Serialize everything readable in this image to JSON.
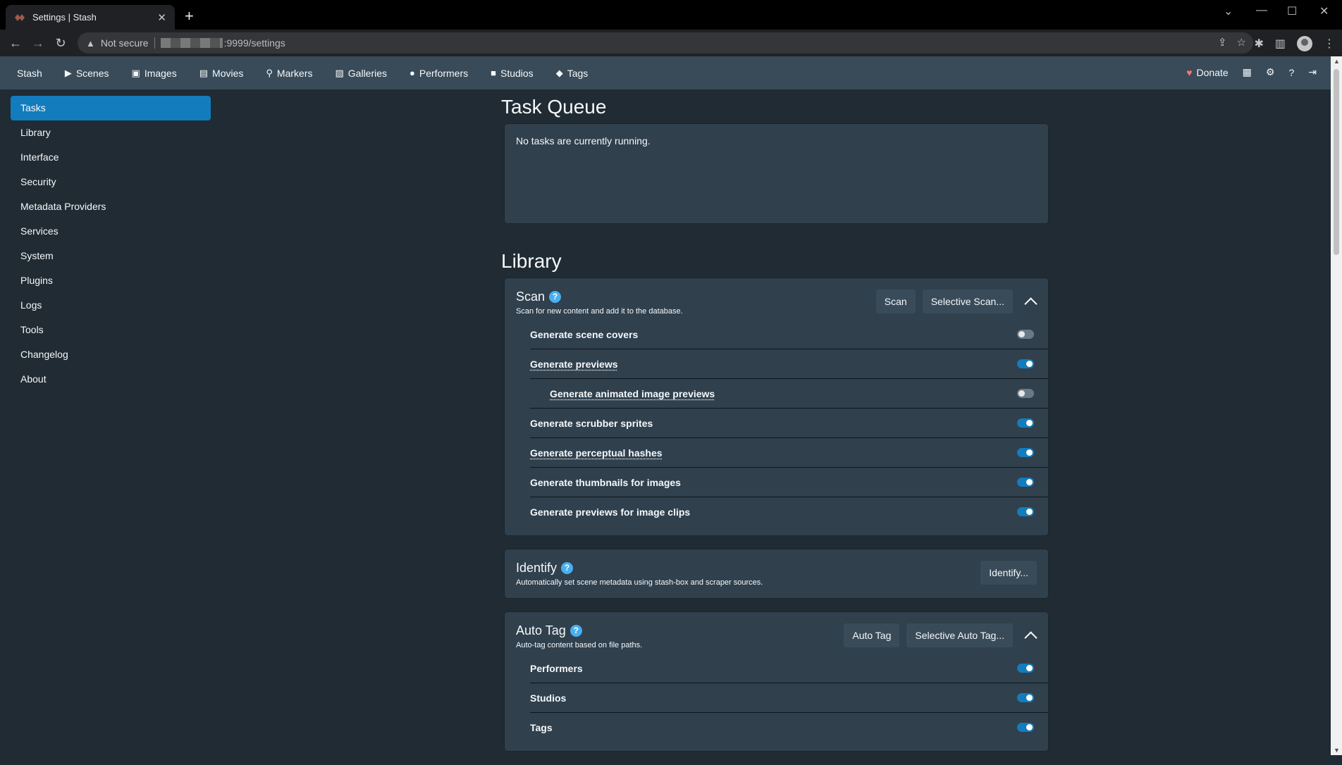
{
  "browser": {
    "tab_title": "Settings | Stash",
    "tab_close": "✕",
    "new_tab": "+",
    "security_label": "Not secure",
    "url": ":9999/settings"
  },
  "nav": {
    "brand": "Stash",
    "items": [
      {
        "label": "Scenes",
        "icon": "play-circle-icon"
      },
      {
        "label": "Images",
        "icon": "image-icon"
      },
      {
        "label": "Movies",
        "icon": "film-icon"
      },
      {
        "label": "Markers",
        "icon": "map-marker-icon"
      },
      {
        "label": "Galleries",
        "icon": "images-icon"
      },
      {
        "label": "Performers",
        "icon": "user-icon"
      },
      {
        "label": "Studios",
        "icon": "video-icon"
      },
      {
        "label": "Tags",
        "icon": "tag-icon"
      }
    ],
    "donate": "Donate"
  },
  "sidebar": {
    "items": [
      "Tasks",
      "Library",
      "Interface",
      "Security",
      "Metadata Providers",
      "Services",
      "System",
      "Plugins",
      "Logs",
      "Tools",
      "Changelog",
      "About"
    ],
    "active": "Tasks"
  },
  "task_queue": {
    "heading": "Task Queue",
    "empty_text": "No tasks are currently running."
  },
  "library": {
    "heading": "Library",
    "scan": {
      "title": "Scan",
      "help": "?",
      "description": "Scan for new content and add it to the database.",
      "button_scan": "Scan",
      "button_selective": "Selective Scan...",
      "options": [
        {
          "label": "Generate scene covers",
          "on": false
        },
        {
          "label": "Generate previews",
          "on": true
        },
        {
          "label": "Generate animated image previews",
          "on": false
        },
        {
          "label": "Generate scrubber sprites",
          "on": true
        },
        {
          "label": "Generate perceptual hashes",
          "on": true
        },
        {
          "label": "Generate thumbnails for images",
          "on": true
        },
        {
          "label": "Generate previews for image clips",
          "on": true
        }
      ]
    },
    "identify": {
      "title": "Identify",
      "help": "?",
      "description": "Automatically set scene metadata using stash-box and scraper sources.",
      "button": "Identify..."
    },
    "autotag": {
      "title": "Auto Tag",
      "help": "?",
      "description": "Auto-tag content based on file paths.",
      "button_autotag": "Auto Tag",
      "button_selective": "Selective Auto Tag...",
      "options": [
        {
          "label": "Performers",
          "on": true
        },
        {
          "label": "Studios",
          "on": true
        },
        {
          "label": "Tags",
          "on": true
        }
      ]
    }
  },
  "colors": {
    "active_blue": "#137cbd",
    "navbar": "#394b59",
    "page_bg": "#202b33",
    "card_bg": "#30404d",
    "help_blue": "#48aff0",
    "donate_heart": "#ff7373"
  }
}
